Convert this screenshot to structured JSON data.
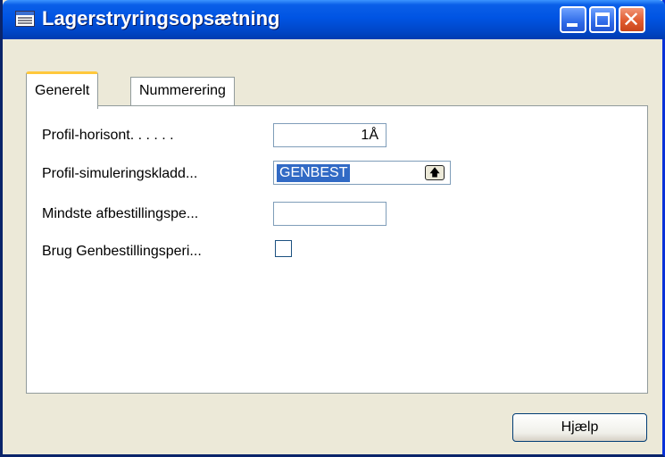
{
  "window": {
    "title": "Lagerstryringsopsætning",
    "icon": "form-icon",
    "controls": [
      "minimize",
      "maximize",
      "close"
    ]
  },
  "tabs": [
    {
      "label": "Generelt",
      "active": true
    },
    {
      "label": "Nummerering",
      "active": false
    }
  ],
  "fields": {
    "profil_horisont": {
      "label": "Profil-horisont. . . . . .",
      "value": "1Å"
    },
    "profil_simulering": {
      "label": "Profil-simuleringskladd...",
      "value": "GENBEST",
      "lookup_icon": "arrow-up-icon"
    },
    "mindste_afbestilling": {
      "label": "Mindste afbestillingspe...",
      "value": ""
    },
    "brug_genbestilling": {
      "label": "Brug Genbestillingsperi...",
      "checked": false
    }
  },
  "buttons": {
    "help": "Hjælp"
  },
  "colors": {
    "titlebar": "#0054e3",
    "close_button": "#e05b2f",
    "selection": "#316ac5",
    "active_tab_accent": "#ffc83c",
    "window_bg": "#ece9d8"
  }
}
